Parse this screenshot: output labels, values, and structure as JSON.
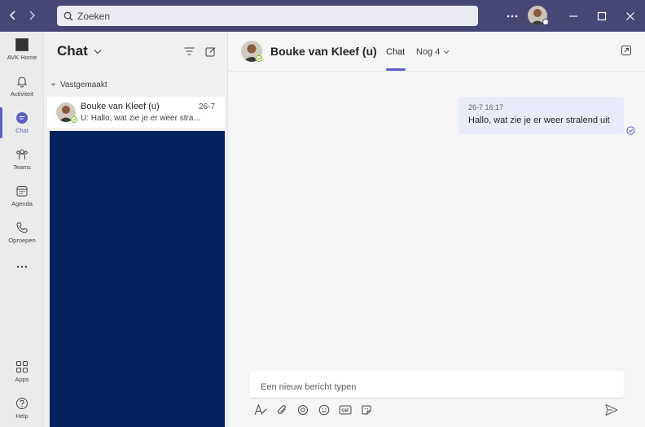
{
  "search": {
    "placeholder": "Zoeken"
  },
  "rail": {
    "items": [
      {
        "label": "AVK Home",
        "icon": "org-logo-icon"
      },
      {
        "label": "Activiteit",
        "icon": "bell-icon"
      },
      {
        "label": "Chat",
        "icon": "chat-icon"
      },
      {
        "label": "Teams",
        "icon": "teams-icon"
      },
      {
        "label": "Agenda",
        "icon": "calendar-icon"
      },
      {
        "label": "Oproepen",
        "icon": "phone-icon"
      },
      {
        "label": "Apps",
        "icon": "apps-icon"
      },
      {
        "label": "Help",
        "icon": "help-icon"
      }
    ]
  },
  "chatlist": {
    "title": "Chat",
    "pinned_label": "Vastgemaakt",
    "items": [
      {
        "name": "Bouke van Kleef (u)",
        "date": "26-7",
        "preview": "U: Hallo, wat zie je er weer stralend uit"
      }
    ]
  },
  "conversation": {
    "name": "Bouke van Kleef (u)",
    "tabs": [
      {
        "label": "Chat"
      },
      {
        "label": "Nog 4"
      }
    ],
    "messages": [
      {
        "time": "26-7 16:17",
        "text": "Hallo, wat zie je er weer stralend uit"
      }
    ],
    "composer_placeholder": "Een nieuw bericht typen"
  },
  "colors": {
    "titlebar": "#464775",
    "accent": "#5b5fc7",
    "bubble": "#e8ebfa",
    "dark_block": "#03225f"
  }
}
